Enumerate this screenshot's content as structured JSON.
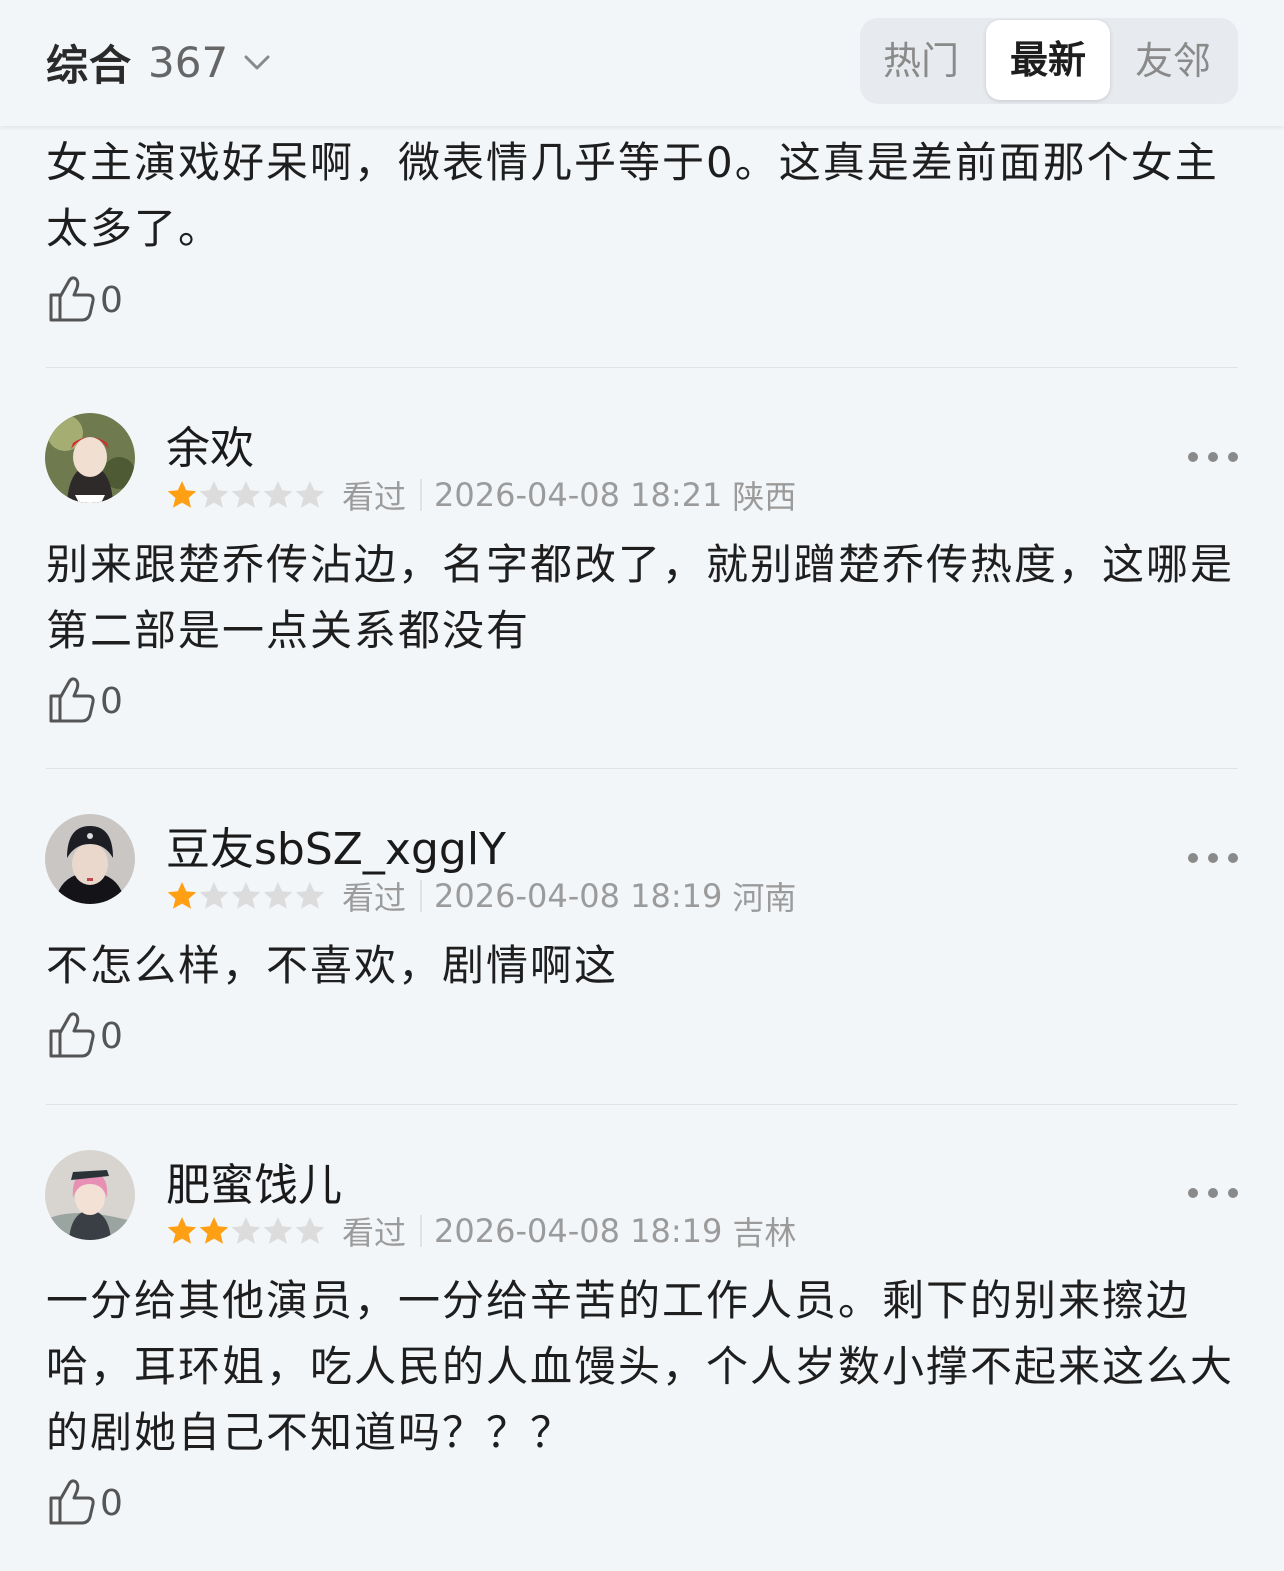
{
  "header": {
    "sort_label": "综合",
    "total_count": "367",
    "tabs": [
      {
        "label": "热门",
        "active": false
      },
      {
        "label": "最新",
        "active": true
      },
      {
        "label": "友邻",
        "active": false
      }
    ]
  },
  "reviews": [
    {
      "content": "女主演戏好呆啊，微表情几乎等于0。这真是差前面那个女主太多了。",
      "likes": "0"
    },
    {
      "username": "余欢",
      "rating": 1,
      "max_rating": 5,
      "status": "看过",
      "datetime": "2026-04-08 18:21",
      "location": "陕西",
      "content": "别来跟楚乔传沾边，名字都改了，就别蹭楚乔传热度，这哪是第二部是一点关系都没有",
      "likes": "0"
    },
    {
      "username": "豆友sbSZ_xgglY",
      "rating": 1,
      "max_rating": 5,
      "status": "看过",
      "datetime": "2026-04-08 18:19",
      "location": "河南",
      "content": "不怎么样，不喜欢，剧情啊这",
      "likes": "0"
    },
    {
      "username": "肥蜜饯儿",
      "rating": 2,
      "max_rating": 5,
      "status": "看过",
      "datetime": "2026-04-08 18:19",
      "location": "吉林",
      "content": "一分给其他演员，一分给辛苦的工作人员。剩下的别来擦边哈，耳环姐，吃人民的人血馒头，个人岁数小撑不起来这么大的剧她自己不知道吗？？？",
      "likes": "0"
    }
  ],
  "icons": {
    "like": "thumbs-up-icon",
    "more": "more-dots-icon",
    "dropdown": "chevron-down-icon",
    "star": "star-icon"
  },
  "colors": {
    "star_filled": "#ff9f14",
    "star_empty": "#dcdcdc",
    "background": "#f3f6f9"
  }
}
